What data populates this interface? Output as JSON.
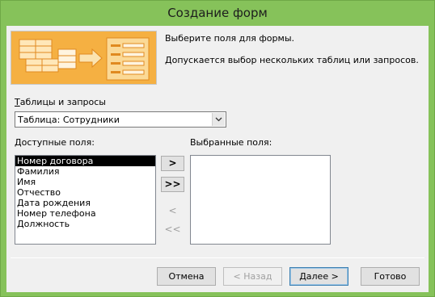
{
  "window": {
    "title": "Создание форм"
  },
  "intro": {
    "line1": "Выберите поля для формы.",
    "line2": "Допускается выбор нескольких таблиц или запросов."
  },
  "tables": {
    "label_accel": "Т",
    "label_rest": "аблицы и запросы",
    "selected": "Таблица: Сотрудники"
  },
  "available": {
    "label_accel": "Д",
    "label_rest": "оступные поля:",
    "items": [
      "Номер договора",
      "Фамилия",
      "Имя",
      "Отчество",
      "Дата рождения",
      "Номер телефона",
      "Должность"
    ]
  },
  "selected_fields": {
    "label": "Выбранные поля:",
    "items": []
  },
  "move_buttons": {
    "add_one": ">",
    "add_all": ">>",
    "remove_one": "<",
    "remove_all": "<<"
  },
  "footer": {
    "cancel": "Отмена",
    "back": "< Назад",
    "next": "Далее >",
    "finish": "Готово"
  },
  "colors": {
    "title_bar": "#86c25a",
    "selection": "#000000",
    "banner_accent": "#f5a623"
  }
}
